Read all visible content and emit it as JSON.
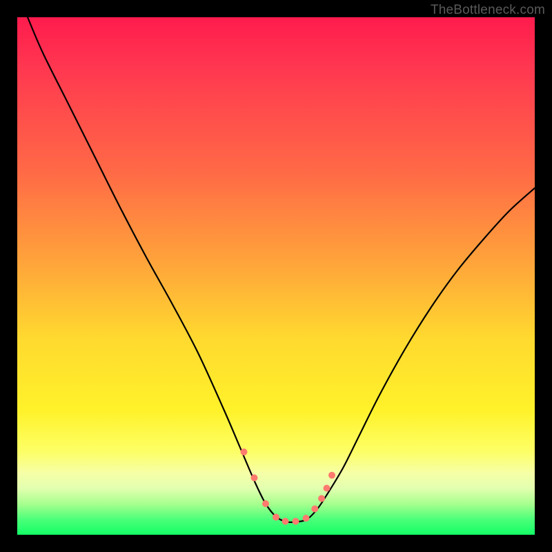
{
  "watermark": {
    "text": "TheBottleneck.com"
  },
  "chart_data": {
    "type": "line",
    "title": "",
    "xlabel": "",
    "ylabel": "",
    "xlim": [
      0,
      100
    ],
    "ylim": [
      0,
      100
    ],
    "grid": false,
    "legend": false,
    "background": {
      "gradient_stops": [
        {
          "pos": 0,
          "color": "#ff1b4d"
        },
        {
          "pos": 30,
          "color": "#ff6a46"
        },
        {
          "pos": 62,
          "color": "#ffd92f"
        },
        {
          "pos": 88,
          "color": "#f6ffa6"
        },
        {
          "pos": 100,
          "color": "#12ff66"
        }
      ]
    },
    "series": [
      {
        "name": "curve",
        "color": "#000000",
        "x": [
          2,
          5,
          10,
          15,
          20,
          25,
          30,
          35,
          40,
          43,
          46,
          48,
          50,
          52,
          54,
          56,
          58,
          60,
          63,
          66,
          70,
          75,
          80,
          85,
          90,
          95,
          100
        ],
        "y": [
          100,
          93,
          83,
          73,
          63,
          53.5,
          44.5,
          35,
          24,
          17,
          10,
          6,
          3.5,
          2.5,
          2.5,
          3,
          5,
          8,
          13,
          19,
          27,
          36,
          44,
          51,
          57,
          62.5,
          67
        ]
      }
    ],
    "markers": {
      "name": "points",
      "color": "#ff7a6e",
      "radius": 5,
      "x": [
        43.8,
        45.8,
        48.0,
        50.0,
        51.8,
        53.8,
        55.8,
        57.5,
        58.8,
        59.8,
        60.8
      ],
      "y": [
        16.0,
        11.0,
        6.0,
        3.4,
        2.6,
        2.6,
        3.2,
        5.0,
        7.0,
        9.0,
        11.5
      ]
    }
  }
}
